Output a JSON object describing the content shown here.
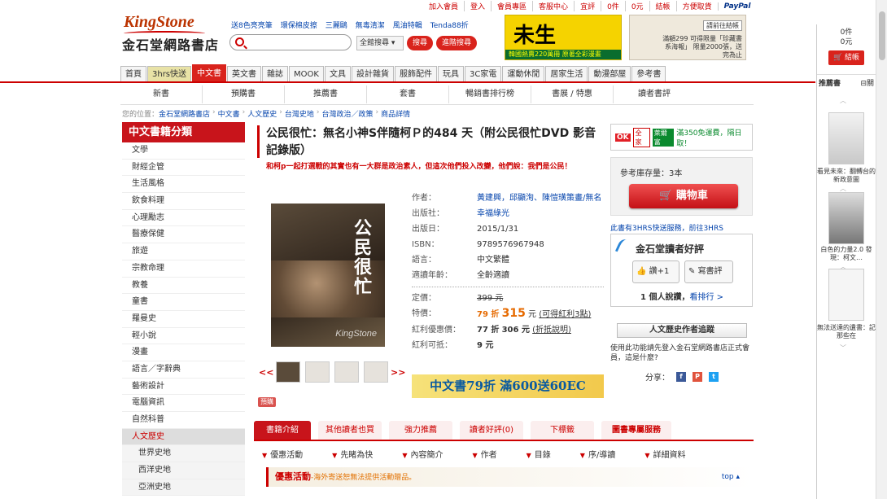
{
  "topbar": [
    "加入會員",
    "登入",
    "會員專區",
    "客服中心",
    "宜評",
    "0件",
    "0元",
    "結帳",
    "方便取貨",
    "PayPal"
  ],
  "logo": {
    "en": "KingStone",
    "cn": "金石堂網路書店"
  },
  "hotwords": [
    "送8色亮亮筆",
    "環保棉皮擦",
    "三麗鷗",
    "無毒清潔",
    "風油特輯",
    "Tenda88折"
  ],
  "search": {
    "placeholder": "",
    "scope": "全館搜尋 ▾",
    "btn_search": "搜尋",
    "btn_advanced": "進階搜尋"
  },
  "banners": {
    "b1_big": "未生",
    "b1_strip": "韓國熱賣220萬冊 原著全彩漫畫",
    "b2_tag": "請前往結帳",
    "b2_text": "滿額299 可得限量「珍藏書系海報」 限量2000張，送完為止"
  },
  "mainnav": [
    "首頁",
    "3hrs快送",
    "中文書",
    "英文書",
    "雜誌",
    "MOOK",
    "文具",
    "設計雜貨",
    "服飾配件",
    "玩具",
    "3C家電",
    "運動休閒",
    "居家生活",
    "動漫部屋",
    "參考書"
  ],
  "subnav": [
    "新書",
    "預購書",
    "推薦書",
    "套書",
    "暢銷書排行榜",
    "書展 / 特惠",
    "讀者書評"
  ],
  "breadcrumb": {
    "prefix": "您的位置：",
    "items": [
      "金石堂網路書店",
      "中文書",
      "人文歷史",
      "台灣史地",
      "台灣政治／政策",
      "商品詳情"
    ]
  },
  "sidebar": {
    "title": "中文書籍分類",
    "items": [
      "文學",
      "財經企管",
      "生活風格",
      "飲食料理",
      "心理勵志",
      "醫療保健",
      "旅遊",
      "宗教命理",
      "教養",
      "童書",
      "羅曼史",
      "輕小說",
      "漫畫",
      "語言／字辭典",
      "藝術設計",
      "電腦資訊",
      "自然科普",
      "人文歷史",
      "世界史地",
      "西洋史地",
      "亞洲史地"
    ]
  },
  "product": {
    "title": "公民很忙：無名小神S伴隨柯Ｐ的484 天（附公民很忙DVD 影音記錄版）",
    "subtitle": "和柯p一起打選戰的其實也有一大群是政治素人，但這次他們投入改變，他們說：我們是公民！",
    "cover_title": "公民很忙",
    "cover_watermark": "KingStone",
    "thumb_prev": "<<",
    "thumb_next": ">>",
    "preview": "預購",
    "labels": {
      "author": "作者：",
      "publisher": "出版社：",
      "date": "出版日：",
      "isbn": "ISBN：",
      "lang": "語言：",
      "age": "適讀年齡：",
      "list": "定價：",
      "special": "特價：",
      "bonus": "紅利優惠價：",
      "bonus_pts": "紅利可抵："
    },
    "author": "黃建興，邱顯洵、陳愷璜策畫/無名",
    "publisher": "幸福綠光",
    "date": "2015/1/31",
    "isbn": "9789576967948",
    "lang": "中文繁體",
    "age": "全齡適讀",
    "list_price": "399 元",
    "special_disc": "79 折",
    "special_price": "315",
    "special_unit": "元",
    "special_note": "(可得紅利3點)",
    "bonus_disc": "77 折",
    "bonus_price": "306 元",
    "bonus_note": "(折抵說明)",
    "bonus_pts": "9 元",
    "promo_banner": "中文書79折  滿600送60EC"
  },
  "rightcol": {
    "ok": "OK",
    "fm": "全家",
    "hl": "萊爾富",
    "store_text": "滿350免運費，隔日取！",
    "stock": "參考庫存量：3本",
    "cart": "購物車",
    "hrs_link": "此書有3HRS快送服務，前往3HRS",
    "review_title": "金石堂讀者好評",
    "like": "讚+1",
    "write": "寫書評",
    "review_count": "1 個人說讚，",
    "review_rank": "看排行 >",
    "author_btn": "人文歷史作者追蹤",
    "member_text": "使用此功能請先登入金石堂網路書店正式會員，這是什麼?",
    "share_label": "分享："
  },
  "ptabs": [
    "書籍介紹",
    "其他讀者也買",
    "強力推薦",
    "讀者好評(0)",
    "下標籤",
    "圖書專屬服務"
  ],
  "secnav": [
    "優惠活動",
    "先睹為快",
    "內容簡介",
    "作者",
    "目錄",
    "序/導讀",
    "詳細資料"
  ],
  "promo_row": {
    "title": "優惠活動",
    "note": "-海外寄送恕無法提供活動贈品。",
    "top": "top ▴"
  },
  "rpanel": {
    "count": "0件",
    "amount": "0元",
    "checkout": "結帳",
    "rec_title": "推薦書",
    "rec_min": "⊟關",
    "books": [
      {
        "cap": "看見未來：翻轉台的新政意圖"
      },
      {
        "cap": "白色的力量2.0 發現：柯文…"
      },
      {
        "cap": "無法送達的遺書：記那些在"
      }
    ]
  }
}
